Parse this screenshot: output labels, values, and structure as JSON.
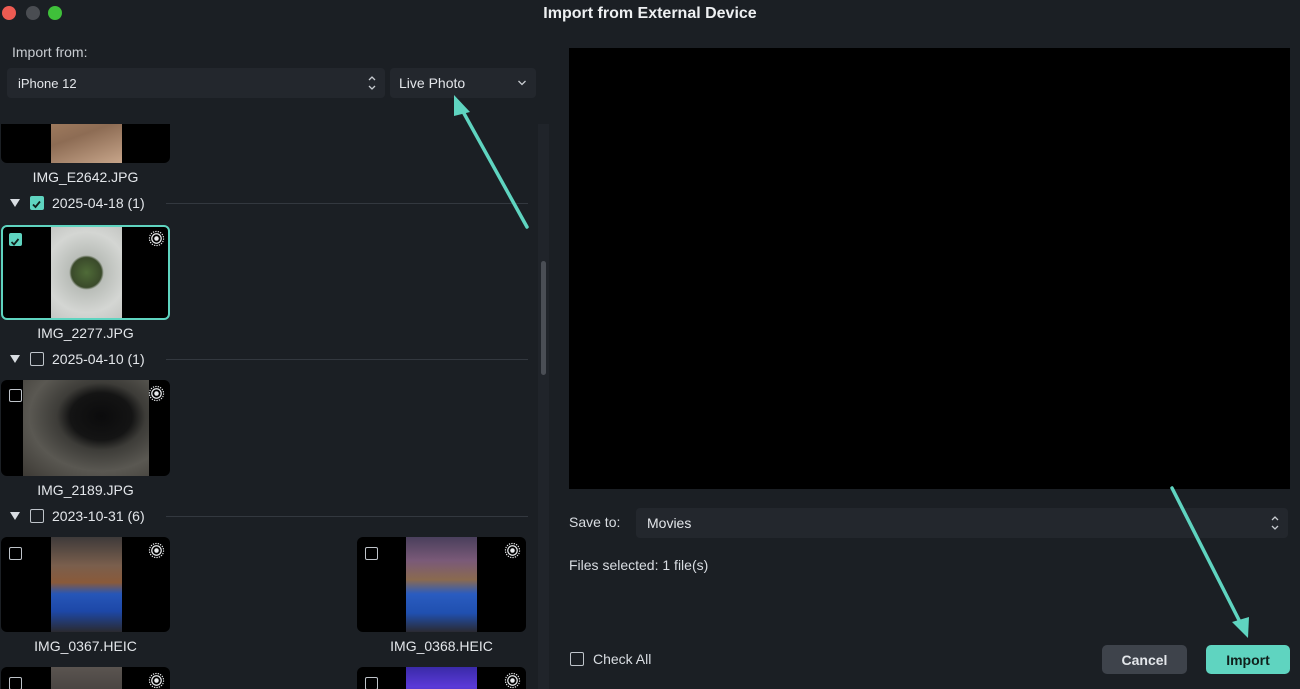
{
  "window": {
    "title": "Import from External Device"
  },
  "import_from": {
    "label": "Import from:",
    "device": "iPhone 12",
    "media_type": "Live Photo"
  },
  "groups": [
    {
      "label": "2025-04-18 (1)",
      "checked": true
    },
    {
      "label": "2025-04-10 (1)",
      "checked": false
    },
    {
      "label": "2023-10-31 (6)",
      "checked": false
    }
  ],
  "files": [
    {
      "name": "IMG_E2642.JPG",
      "selected": false
    },
    {
      "name": "IMG_2277.JPG",
      "selected": true,
      "live": true
    },
    {
      "name": "IMG_2189.JPG",
      "selected": false,
      "live": true
    },
    {
      "name": "IMG_0367.HEIC",
      "selected": false,
      "live": true
    },
    {
      "name": "IMG_0368.HEIC",
      "selected": false,
      "live": true
    }
  ],
  "save_to": {
    "label": "Save to:",
    "value": "Movies"
  },
  "status": {
    "files_selected": "Files selected: 1 file(s)"
  },
  "footer": {
    "check_all_label": "Check All",
    "cancel_label": "Cancel",
    "import_label": "Import"
  },
  "colors": {
    "accent": "#5fd4c0",
    "arrow": "#5fd4c0",
    "background": "#1b1f24"
  }
}
